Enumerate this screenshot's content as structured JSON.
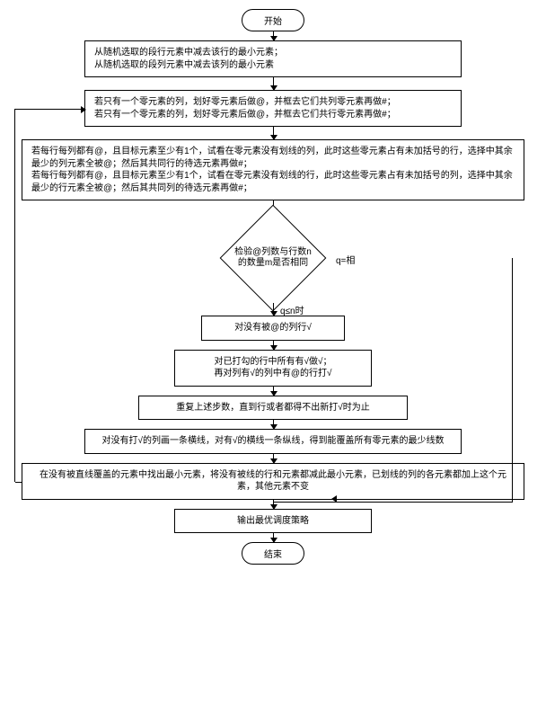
{
  "start": "开始",
  "end": "结束",
  "step1": "从随机选取的段行元素中减去该行的最小元素；\n从随机选取的段列元素中减去该列的最小元素",
  "step2": "若只有一个零元素的列，划好零元素后做@，并框去它们共列零元素再做#；\n若只有一个零元素的列，划好零元素后做@，并框去它们共行零元素再做#；",
  "step3": "若每行每列都有@，且目标元素至少有1个，试看在零元素没有划线的列，此时这些零元素占有未加括号的行，选择中其余最少的列元素全被@；然后其共同行的待选元素再做#；\n若每行每列都有@，且目标元素至少有1个，试看在零元素没有划线的行，此时这些零元素占有未加括号的列，选择中其余最少的行元素全被@；然后其共同列的待选元素再做#；",
  "decision": "检验@列数与行数n的数量m是否相同",
  "branch_yes": "q=相",
  "branch_no": "q≤n时",
  "step4": "对没有被@的列行√",
  "step5": "对已打勾的行中所有有√做√；\n再对列有√的列中有@的行打√",
  "step6": "重复上述步数，直到行或者都得不出新打√时为止",
  "step7": "对没有打√的列画一条横线，对有√的横线一条纵线，得到能覆盖所有零元素的最少线数",
  "step8": "在没有被直线覆盖的元素中找出最小元素，将没有被线的行和元素都减此最小元素，已划线的列的各元素都加上这个元素，其他元素不变",
  "step9": "输出最优调度策略"
}
